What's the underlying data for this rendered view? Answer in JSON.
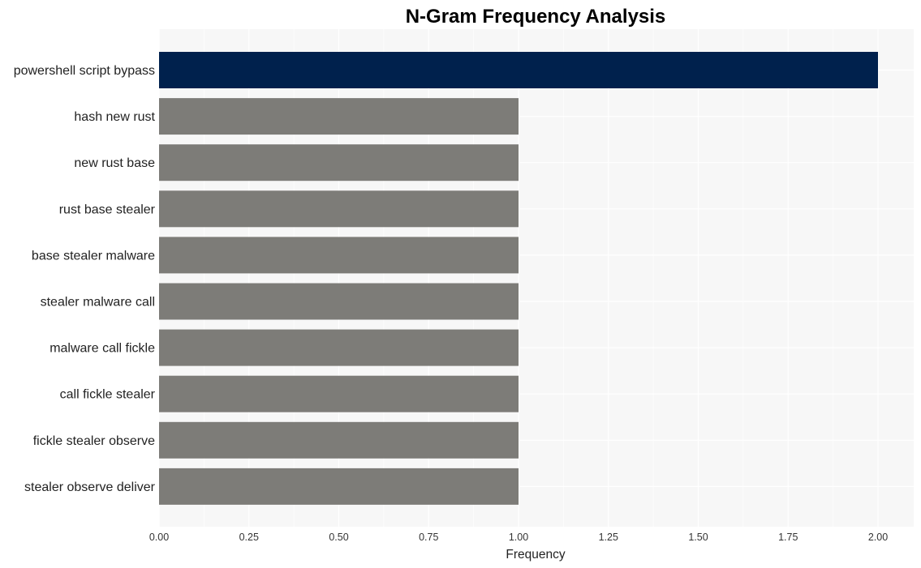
{
  "chart_data": {
    "type": "bar",
    "orientation": "horizontal",
    "title": "N-Gram Frequency Analysis",
    "xlabel": "Frequency",
    "ylabel": "",
    "xlim": [
      0,
      2.0
    ],
    "grid": true,
    "x_ticks": [
      "0.00",
      "0.25",
      "0.50",
      "0.75",
      "1.00",
      "1.25",
      "1.50",
      "1.75",
      "2.00"
    ],
    "x_tick_values": [
      0,
      0.25,
      0.5,
      0.75,
      1.0,
      1.25,
      1.5,
      1.75,
      2.0
    ],
    "categories": [
      "powershell script bypass",
      "hash new rust",
      "new rust base",
      "rust base stealer",
      "base stealer malware",
      "stealer malware call",
      "malware call fickle",
      "call fickle stealer",
      "fickle stealer observe",
      "stealer observe deliver"
    ],
    "values": [
      2,
      1,
      1,
      1,
      1,
      1,
      1,
      1,
      1,
      1
    ],
    "colors": {
      "highlight": "#00214d",
      "default": "#7d7c78",
      "panel_background": "#f7f7f7",
      "grid": "#ffffff"
    }
  }
}
